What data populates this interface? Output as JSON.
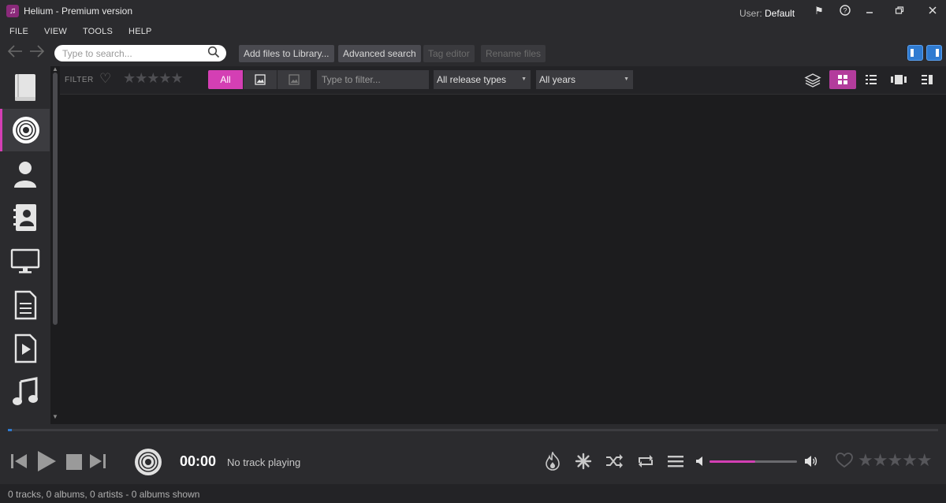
{
  "window": {
    "title": "Helium - Premium version",
    "user_prefix": "User:",
    "user_name": "Default"
  },
  "menu": [
    "FILE",
    "VIEW",
    "TOOLS",
    "HELP"
  ],
  "toolbar": {
    "search_placeholder": "Type to search...",
    "add_files_label": "Add files to Library...",
    "advanced_search_label": "Advanced search",
    "tag_editor_label": "Tag editor",
    "rename_files_label": "Rename files"
  },
  "sidebar": {
    "items": [
      {
        "icon": "library-book-icon"
      },
      {
        "icon": "album-disc-icon",
        "active": true
      },
      {
        "icon": "artist-person-icon"
      },
      {
        "icon": "contacts-card-icon"
      },
      {
        "icon": "monitor-icon"
      },
      {
        "icon": "document-list-icon"
      },
      {
        "icon": "video-play-icon"
      },
      {
        "icon": "music-note-icon"
      }
    ]
  },
  "filter": {
    "label": "FILTER",
    "all_label": "All",
    "filter_placeholder": "Type to filter...",
    "release_types": "All release types",
    "years": "All years"
  },
  "player": {
    "time": "00:00",
    "status": "No track playing",
    "volume_fraction": 0.52,
    "seek_fraction": 0.004
  },
  "statusbar": {
    "text": "0 tracks, 0 albums, 0 artists - 0 albums shown"
  },
  "colors": {
    "accent": "#d43fb4",
    "panel": "#2b2b2e",
    "background": "#1c1c1e",
    "blue": "#2f7bd1"
  }
}
